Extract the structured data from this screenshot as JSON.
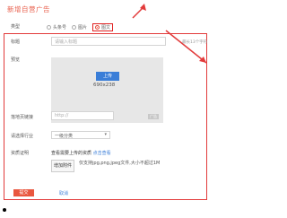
{
  "page": {
    "title": "新增自营广告"
  },
  "form": {
    "type_label": "类型",
    "type_options": [
      "头条号",
      "图片",
      "图文"
    ],
    "title_label": "标题",
    "title_placeholder": "请输入标题",
    "title_hint": "最长13个字符",
    "preview_label": "预览",
    "upload_label": "上传",
    "size_text": "690x238",
    "preview_tag": "广告",
    "landing_label": "落地页链接",
    "landing_placeholder": "http://",
    "industry_label": "请选择行业",
    "industry_value": "一级分类",
    "qualification_label": "资质证明",
    "qualification_text": "查看需要上传的资质",
    "qualification_link": "点击查看",
    "attachment_button": "增加附件",
    "attachment_note": "仅支持jpg,png,jpeg文件,大小不超过1M",
    "submit_label": "提交",
    "cancel_label": "取消"
  },
  "colors": {
    "accent": "#e23b3b",
    "link": "#3a7ed8"
  }
}
